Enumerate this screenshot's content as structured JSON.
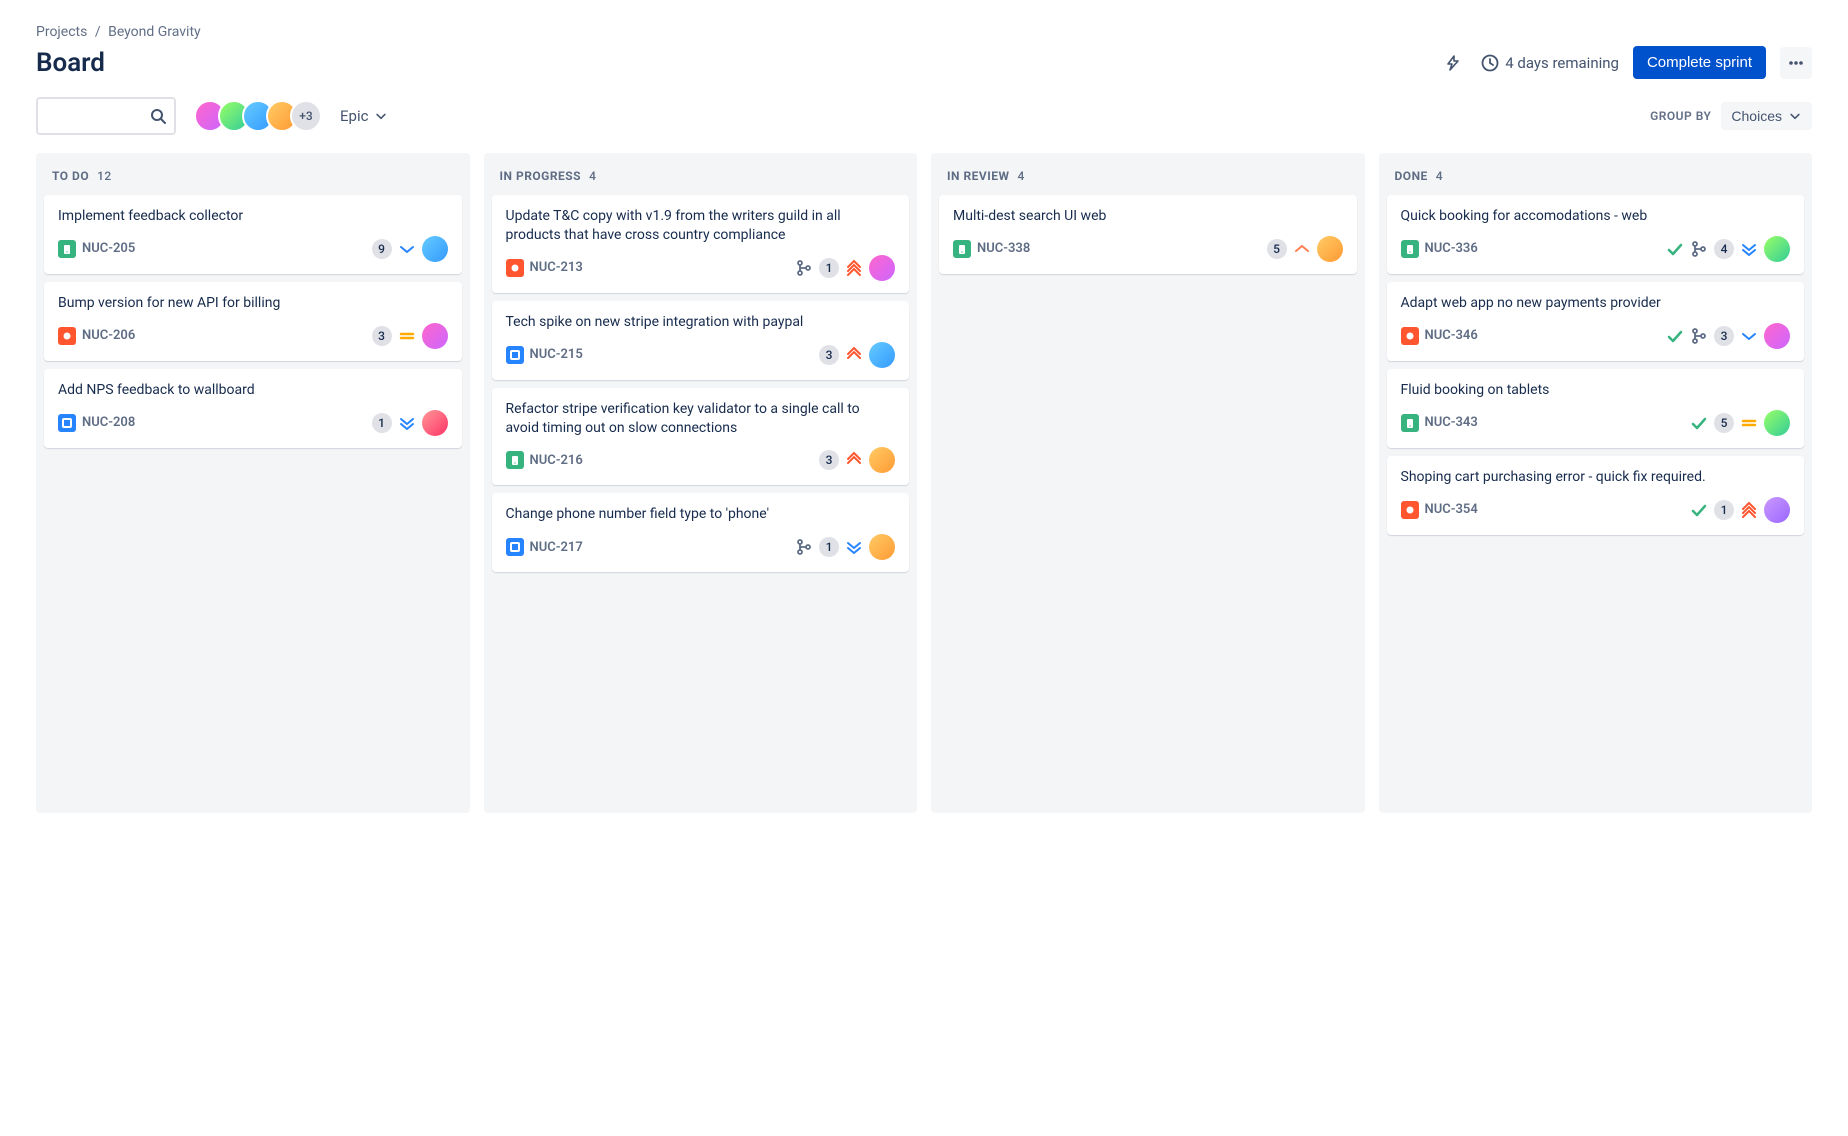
{
  "breadcrumb": {
    "root": "Projects",
    "project": "Beyond Gravity"
  },
  "page_title": "Board",
  "header": {
    "remaining_text": "4 days remaining",
    "complete_sprint": "Complete sprint"
  },
  "toolbar": {
    "search_placeholder": "",
    "avatar_overflow": "+3",
    "filter_label": "Epic",
    "groupby_label": "GROUP BY",
    "groupby_value": "Choices"
  },
  "columns": [
    {
      "name": "TO DO",
      "count": 12
    },
    {
      "name": "IN PROGRESS",
      "count": 4
    },
    {
      "name": "IN REVIEW",
      "count": 4
    },
    {
      "name": "DONE",
      "count": 4
    }
  ],
  "cards": {
    "todo": [
      {
        "title": "Implement feedback collector",
        "key": "NUC-205",
        "type": "story",
        "estimate": 9,
        "priority": "low",
        "branch": false,
        "done": false,
        "avatar": "av-b"
      },
      {
        "title": "Bump version for new API for billing",
        "key": "NUC-206",
        "type": "bug",
        "estimate": 3,
        "priority": "medium",
        "branch": false,
        "done": false,
        "avatar": "av-a"
      },
      {
        "title": "Add NPS feedback to wallboard",
        "key": "NUC-208",
        "type": "task",
        "estimate": 1,
        "priority": "lowest",
        "branch": false,
        "done": false,
        "avatar": "av-e"
      }
    ],
    "in_progress": [
      {
        "title": "Update T&C copy with v1.9 from the writers guild in all products that have cross country compliance",
        "key": "NUC-213",
        "type": "bug",
        "estimate": 1,
        "priority": "highest",
        "branch": true,
        "done": false,
        "avatar": "av-a"
      },
      {
        "title": "Tech spike on new stripe integration with paypal",
        "key": "NUC-215",
        "type": "task",
        "estimate": 3,
        "priority": "high",
        "branch": false,
        "done": false,
        "avatar": "av-b"
      },
      {
        "title": "Refactor stripe verification key validator to a single call to avoid timing out on slow connections",
        "key": "NUC-216",
        "type": "story",
        "estimate": 3,
        "priority": "high",
        "branch": false,
        "done": false,
        "avatar": "av-c"
      },
      {
        "title": "Change phone number field type to 'phone'",
        "key": "NUC-217",
        "type": "task",
        "estimate": 1,
        "priority": "lowest",
        "branch": true,
        "done": false,
        "avatar": "av-c"
      }
    ],
    "in_review": [
      {
        "title": "Multi-dest search UI web",
        "key": "NUC-338",
        "type": "story",
        "estimate": 5,
        "priority": "medium-high",
        "branch": false,
        "done": false,
        "avatar": "av-c"
      }
    ],
    "done": [
      {
        "title": "Quick booking for accomodations - web",
        "key": "NUC-336",
        "type": "story",
        "estimate": 4,
        "priority": "lowest",
        "branch": true,
        "done": true,
        "avatar": "av-d"
      },
      {
        "title": "Adapt web app no new payments provider",
        "key": "NUC-346",
        "type": "bug",
        "estimate": 3,
        "priority": "low",
        "branch": true,
        "done": true,
        "avatar": "av-a"
      },
      {
        "title": "Fluid booking on tablets",
        "key": "NUC-343",
        "type": "story",
        "estimate": 5,
        "priority": "medium",
        "branch": false,
        "done": true,
        "avatar": "av-d"
      },
      {
        "title": "Shoping cart purchasing error - quick fix required.",
        "key": "NUC-354",
        "type": "bug",
        "estimate": 1,
        "priority": "highest",
        "branch": false,
        "done": true,
        "avatar": "av-f"
      }
    ]
  }
}
